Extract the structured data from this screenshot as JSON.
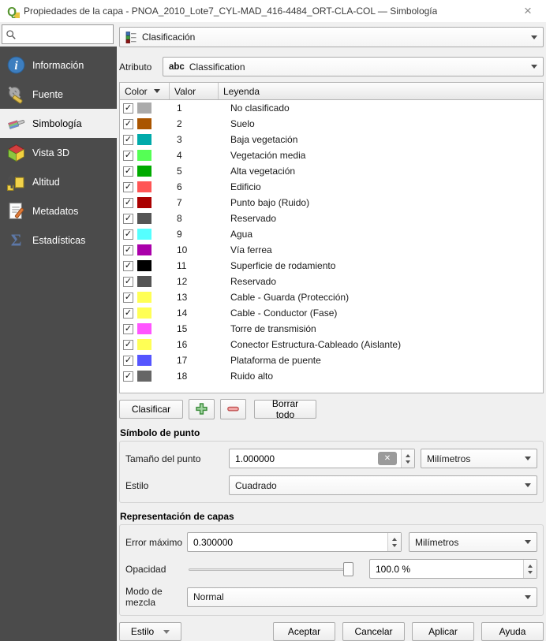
{
  "window": {
    "title": "Propiedades de la capa - PNOA_2010_Lote7_CYL-MAD_416-4484_ORT-CLA-COL — Simbología",
    "close_glyph": "×"
  },
  "colors": {
    "sidebar_bg": "#4b4b4b",
    "dialog_bg": "#f0f0f0",
    "qgis_green": "#589632"
  },
  "search": {
    "value": "",
    "placeholder": ""
  },
  "sidebar": {
    "items": [
      {
        "label": "Información",
        "icon": "info-icon",
        "selected": false
      },
      {
        "label": "Fuente",
        "icon": "source-icon",
        "selected": false
      },
      {
        "label": "Simbología",
        "icon": "symbology-icon",
        "selected": true
      },
      {
        "label": "Vista 3D",
        "icon": "view-3d-icon",
        "selected": false
      },
      {
        "label": "Altitud",
        "icon": "elevation-icon",
        "selected": false
      },
      {
        "label": "Metadatos",
        "icon": "metadata-icon",
        "selected": false
      },
      {
        "label": "Estadísticas",
        "icon": "statistics-icon",
        "selected": false
      }
    ]
  },
  "renderer": {
    "selected": "Clasificación"
  },
  "attribute": {
    "label": "Atributo",
    "type_prefix": "abc",
    "value": "Classification"
  },
  "classification_table": {
    "columns": [
      "Color",
      "Valor",
      "Leyenda"
    ],
    "rows": [
      {
        "checked": true,
        "color": "#aaaaaa",
        "value": "1",
        "legend": "No clasificado"
      },
      {
        "checked": true,
        "color": "#aa5500",
        "value": "2",
        "legend": "Suelo"
      },
      {
        "checked": true,
        "color": "#00aaaa",
        "value": "3",
        "legend": "Baja vegetación"
      },
      {
        "checked": true,
        "color": "#55ff55",
        "value": "4",
        "legend": "Vegetación media"
      },
      {
        "checked": true,
        "color": "#00aa00",
        "value": "5",
        "legend": "Alta vegetación"
      },
      {
        "checked": true,
        "color": "#ff5555",
        "value": "6",
        "legend": "Edificio"
      },
      {
        "checked": true,
        "color": "#aa0000",
        "value": "7",
        "legend": "Punto bajo (Ruido)"
      },
      {
        "checked": true,
        "color": "#555555",
        "value": "8",
        "legend": "Reservado"
      },
      {
        "checked": true,
        "color": "#55ffff",
        "value": "9",
        "legend": "Agua"
      },
      {
        "checked": true,
        "color": "#aa00aa",
        "value": "10",
        "legend": "Vía ferrea"
      },
      {
        "checked": true,
        "color": "#000000",
        "value": "11",
        "legend": "Superficie de rodamiento"
      },
      {
        "checked": true,
        "color": "#555555",
        "value": "12",
        "legend": "Reservado"
      },
      {
        "checked": true,
        "color": "#ffff55",
        "value": "13",
        "legend": "Cable - Guarda (Protección)"
      },
      {
        "checked": true,
        "color": "#ffff55",
        "value": "14",
        "legend": "Cable - Conductor (Fase)"
      },
      {
        "checked": true,
        "color": "#ff55ff",
        "value": "15",
        "legend": "Torre de transmisión"
      },
      {
        "checked": true,
        "color": "#ffff55",
        "value": "16",
        "legend": "Conector Estructura-Cableado (Aislante)"
      },
      {
        "checked": true,
        "color": "#5555ff",
        "value": "17",
        "legend": "Plataforma de puente"
      },
      {
        "checked": true,
        "color": "#666666",
        "value": "18",
        "legend": "Ruido alto"
      }
    ]
  },
  "actions": {
    "classify": "Clasificar",
    "clear_all": "Borrar todo"
  },
  "point_symbol": {
    "title": "Símbolo de punto",
    "size_label": "Tamaño del punto",
    "size_value": "1.000000",
    "size_unit": "Milímetros",
    "style_label": "Estilo",
    "style_value": "Cuadrado"
  },
  "layer_rendering": {
    "title": "Representación de capas",
    "max_error_label": "Error máximo",
    "max_error_value": "0.300000",
    "max_error_unit": "Milímetros",
    "opacity_label": "Opacidad",
    "opacity_percent": 100,
    "opacity_value": "100.0 %",
    "blend_label": "Modo de mezcla",
    "blend_value": "Normal"
  },
  "footer": {
    "style_button": "Estilo",
    "ok": "Aceptar",
    "cancel": "Cancelar",
    "apply": "Aplicar",
    "help": "Ayuda"
  }
}
